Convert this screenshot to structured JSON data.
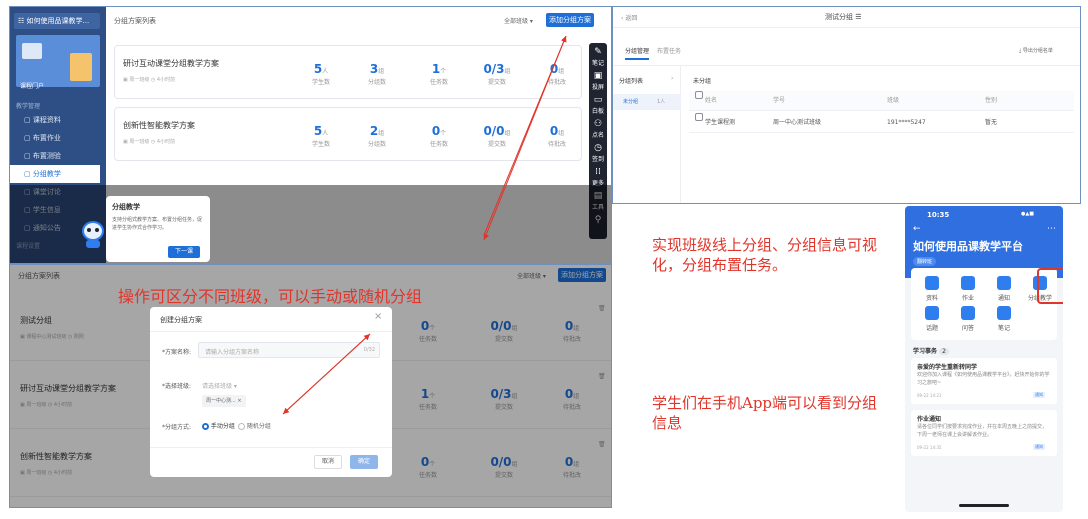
{
  "panel1": {
    "sidebar": {
      "course_title": "如何使用品课教学...",
      "portal": "课程门户",
      "section": "教学管理",
      "items": [
        "课程资料",
        "布置作业",
        "布置测验",
        "分组教学",
        "课堂讨论",
        "学生信息",
        "通知公告"
      ],
      "active_index": 3,
      "bottom_section": "课程设置"
    },
    "header": {
      "title": "分组方案列表",
      "filter": "全部班级",
      "add_button": "添加分组方案"
    },
    "cards": [
      {
        "title": "研讨互动课堂分组教学方案",
        "meta1": "周一班级",
        "meta2": "4小时前",
        "stats": [
          {
            "n": "5",
            "u": "人",
            "l": "学生数"
          },
          {
            "n": "3",
            "u": "组",
            "l": "分组数"
          },
          {
            "n": "1",
            "u": "个",
            "l": "任务数"
          },
          {
            "n": "0/3",
            "u": "组",
            "l": "提交数"
          },
          {
            "n": "0",
            "u": "组",
            "l": "待批改"
          }
        ]
      },
      {
        "title": "创新性智能教学方案",
        "meta1": "周一班级",
        "meta2": "4小时前",
        "stats": [
          {
            "n": "5",
            "u": "人",
            "l": "学生数"
          },
          {
            "n": "2",
            "u": "组",
            "l": "分组数"
          },
          {
            "n": "0",
            "u": "个",
            "l": "任务数"
          },
          {
            "n": "0/0",
            "u": "组",
            "l": "提交数"
          },
          {
            "n": "0",
            "u": "组",
            "l": "待批改"
          }
        ]
      }
    ],
    "toolbar": [
      {
        "g": "✎",
        "l": "笔记"
      },
      {
        "g": "▣",
        "l": "投屏"
      },
      {
        "g": "▭",
        "l": "白板"
      },
      {
        "g": "⚇",
        "l": "点名"
      },
      {
        "g": "◷",
        "l": "签到"
      },
      {
        "g": "⁞⁞",
        "l": "更多"
      },
      {
        "g": "▤",
        "l": "工具"
      },
      {
        "g": "⚲",
        "l": ""
      }
    ],
    "tooltip": {
      "title": "分组教学",
      "body": "支持分组式教学方案、布置分组任务，促进学生协作式合作学习。",
      "next": "下一课"
    }
  },
  "panel2": {
    "header": {
      "title": "分组方案列表",
      "filter": "全部班级",
      "add_button": "添加分组方案"
    },
    "rows": [
      {
        "title": "测试分组",
        "meta1": "课程中心测试班级",
        "meta2": "刚刚",
        "stats": [
          {
            "n": "0",
            "u": "个",
            "l": "任务数"
          },
          {
            "n": "0/0",
            "u": "组",
            "l": "提交数"
          },
          {
            "n": "0",
            "u": "组",
            "l": "待批改"
          }
        ]
      },
      {
        "title": "研讨互动课堂分组教学方案",
        "meta1": "周一班级",
        "meta2": "4小时前",
        "stats": [
          {
            "n": "1",
            "u": "个",
            "l": "任务数"
          },
          {
            "n": "0/3",
            "u": "组",
            "l": "提交数"
          },
          {
            "n": "0",
            "u": "组",
            "l": "待批改"
          }
        ]
      },
      {
        "title": "创新性智能教学方案",
        "meta1": "周一班级",
        "meta2": "4小时前",
        "stats": [
          {
            "n": "0",
            "u": "个",
            "l": "任务数"
          },
          {
            "n": "0/0",
            "u": "组",
            "l": "提交数"
          },
          {
            "n": "0",
            "u": "组",
            "l": "待批改"
          }
        ]
      }
    ],
    "dialog": {
      "title": "创建分组方案",
      "name_label": "*方案名称:",
      "name_placeholder": "请输入分组方案名称",
      "name_count": "0/32",
      "class_label": "*选择班级:",
      "class_value": "请选择班级",
      "class_tag": "周一中心测...",
      "mode_label": "*分组方式:",
      "mode_manual": "手动分组",
      "mode_random": "随机分组",
      "cancel": "取消",
      "confirm": "确定"
    }
  },
  "panel3": {
    "back": "返回",
    "title": "测试分组",
    "tabs": [
      "分组管理",
      "布置任务"
    ],
    "export": "导出分组名单",
    "group_list_label": "分组列表",
    "group_item": "未分组",
    "group_count": "1人",
    "content_title": "未分组",
    "columns": [
      "姓名",
      "学号",
      "班级",
      "性别"
    ],
    "row": {
      "name": "学生课程测",
      "id": "周一中心测试班级",
      "phone": "191****5247",
      "gender": "暂无"
    }
  },
  "phone": {
    "time": "10:35",
    "status": "●▲■",
    "title": "如何使用品课教学平台",
    "badge": "翻转班",
    "icons": [
      "资料",
      "作业",
      "通知",
      "分组教学",
      "话题",
      "问答",
      "笔记"
    ],
    "section_title": "学习事务",
    "section_count": "2",
    "items": [
      {
        "title": "亲爱的学生重新转同学",
        "body": "欢迎你加入课程《如何使用品课教学平台》，赶快开始你的学习之旅吧~",
        "date": "09-22 14:21",
        "tag": "通知"
      },
      {
        "title": "作业通知",
        "body": "请各位同学们按要求完成作业，并在本周五晚上之前提交，下周一老师在课上会讲解该作业。",
        "date": "09-22 14:35",
        "tag": "通知"
      }
    ]
  },
  "annotations": {
    "top_note": "操作可区分不同班级，可以手动或随机分组",
    "right_note1": "实现班级线上分组、分组信息可视化，分组布置任务。",
    "right_note2": "学生们在手机App端可以看到分组信息"
  },
  "colors": {
    "accent": "#1f6fd8",
    "sidebar": "#2e4f86",
    "annotation": "#e0352b",
    "frame": "#6f8fbf"
  }
}
